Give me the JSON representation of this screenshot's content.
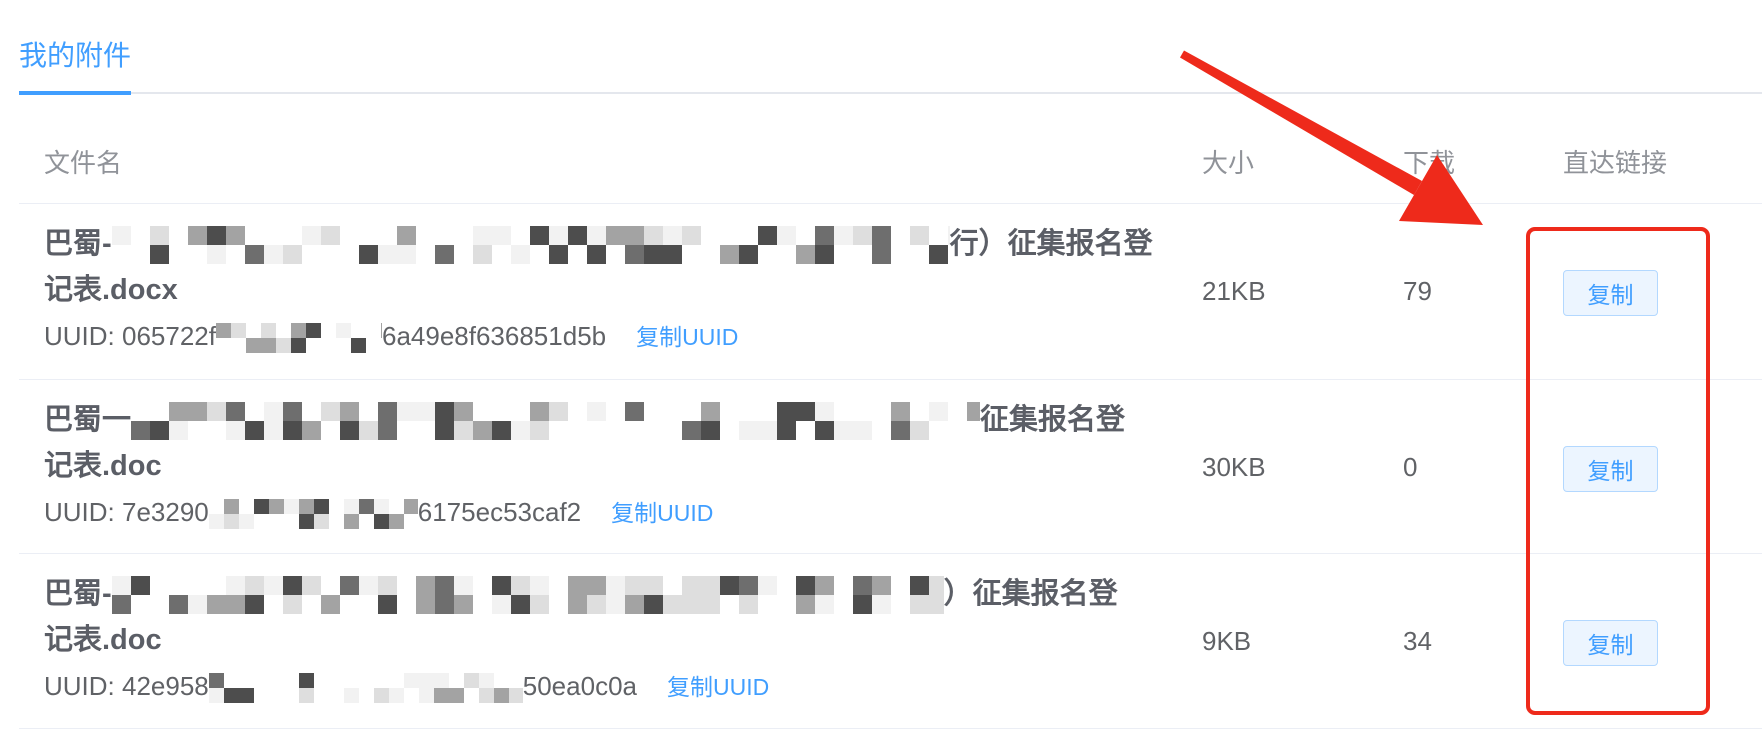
{
  "tabs": [
    {
      "label": "我的附件",
      "active": true
    }
  ],
  "table": {
    "headers": {
      "name": "文件名",
      "size": "大小",
      "downloads": "下载",
      "link": "直达链接"
    },
    "rows": [
      {
        "title_prefix": "巴蜀-",
        "title_suffix": "行）征集报名登",
        "title_line2": "记表.docx",
        "uuid_prefix": "UUID: 065722f",
        "uuid_suffix": "6a49e8f636851d5b",
        "copy_uuid_label": "复制UUID",
        "size": "21KB",
        "downloads": "79",
        "copy_label": "复制"
      },
      {
        "title_prefix": "巴蜀一",
        "title_suffix": "征集报名登",
        "title_line2": "记表.doc",
        "uuid_prefix": "UUID: 7e3290",
        "uuid_suffix": "6175ec53caf2",
        "copy_uuid_label": "复制UUID",
        "size": "30KB",
        "downloads": "0",
        "copy_label": "复制"
      },
      {
        "title_prefix": "巴蜀-",
        "title_suffix": "）征集报名登",
        "title_line2": "记表.doc",
        "uuid_prefix": "UUID: 42e958",
        "uuid_suffix": "50ea0c0a",
        "copy_uuid_label": "复制UUID",
        "size": "9KB",
        "downloads": "34",
        "copy_label": "复制"
      }
    ]
  },
  "colors": {
    "accent": "#409eff",
    "annotation_red": "#ee2a1b",
    "text": "#606266",
    "muted": "#909399",
    "border": "#ebeef5",
    "button_bg": "#ecf5ff",
    "button_border": "#b3d8ff"
  }
}
